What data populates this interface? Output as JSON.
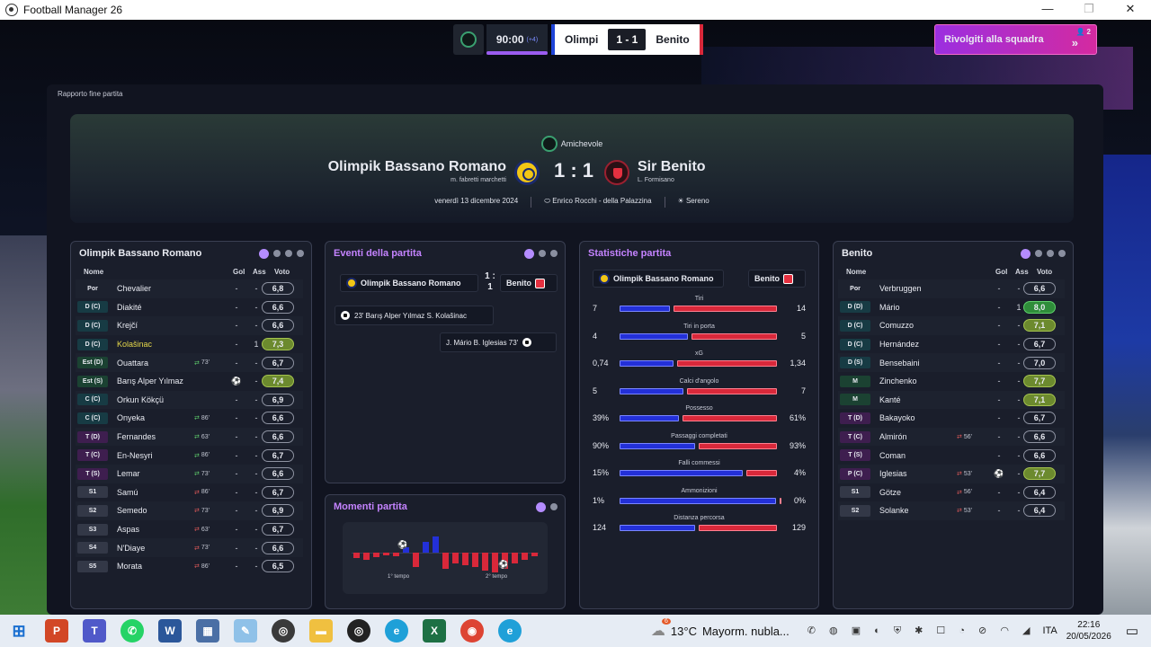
{
  "window": {
    "title": "Football Manager 26",
    "min": "—",
    "max": "❐",
    "close": "✕"
  },
  "topbar": {
    "time": "90:00",
    "extra_time": "(+4)",
    "home_short": "Olimpi",
    "score": "1 - 1",
    "away_short": "Benito",
    "rally_label": "Rivolgiti alla squadra",
    "rally_count": "2",
    "home_color": "#1e44d8",
    "away_color": "#d8283a",
    "accent": "#9b5cf0"
  },
  "breadcrumb": "Rapporto fine partita",
  "header": {
    "competition": "Amichevole",
    "home_team": "Olimpik Bassano Romano",
    "home_coach": "m. fabretti marchetti",
    "away_team": "Sir Benito",
    "away_coach": "L. Formisano",
    "score": "1 : 1",
    "date": "venerdì 13 dicembre 2024",
    "stadium": "Enrico Rocchi - della Palazzina",
    "weather": "Sereno"
  },
  "home_lineup": {
    "title": "Olimpik Bassano Romano",
    "headers": {
      "name": "Nome",
      "goals": "Gol",
      "assists": "Ass",
      "rating": "Voto"
    },
    "players": [
      {
        "pos": "Por",
        "cls": "gk",
        "name": "Chevalier",
        "gol": "-",
        "ass": "-",
        "rating": "6,8",
        "rc": ""
      },
      {
        "pos": "D (C)",
        "cls": "def",
        "name": "Diakité",
        "gol": "-",
        "ass": "-",
        "rating": "6,6",
        "rc": ""
      },
      {
        "pos": "D (C)",
        "cls": "def",
        "name": "Krejčí",
        "gol": "-",
        "ass": "-",
        "rating": "6,6",
        "rc": ""
      },
      {
        "pos": "D (C)",
        "cls": "def",
        "name": "Kolašinac",
        "gol": "-",
        "ass": "1",
        "rating": "7,3",
        "rc": "good",
        "hl": true
      },
      {
        "pos": "Est (D)",
        "cls": "mid",
        "name": "Ouattara",
        "gol": "-",
        "ass": "-",
        "rating": "6,7",
        "rc": "",
        "sub": "73'",
        "dir": "in"
      },
      {
        "pos": "Est (S)",
        "cls": "mid",
        "name": "Barış Alper Yılmaz",
        "gol": "",
        "ass": "-",
        "rating": "7,4",
        "rc": "good",
        "goal": true
      },
      {
        "pos": "C (C)",
        "cls": "def",
        "name": "Orkun Kökçü",
        "gol": "-",
        "ass": "-",
        "rating": "6,9",
        "rc": ""
      },
      {
        "pos": "C (C)",
        "cls": "def",
        "name": "Onyeka",
        "gol": "-",
        "ass": "-",
        "rating": "6,6",
        "rc": "",
        "sub": "86'",
        "dir": "in"
      },
      {
        "pos": "T (D)",
        "cls": "att",
        "name": "Fernandes",
        "gol": "-",
        "ass": "-",
        "rating": "6,6",
        "rc": "",
        "sub": "63'",
        "dir": "in"
      },
      {
        "pos": "T (C)",
        "cls": "att",
        "name": "En-Nesyri",
        "gol": "-",
        "ass": "-",
        "rating": "6,7",
        "rc": "",
        "sub": "86'",
        "dir": "in"
      },
      {
        "pos": "T (S)",
        "cls": "att",
        "name": "Lemar",
        "gol": "-",
        "ass": "-",
        "rating": "6,6",
        "rc": "",
        "sub": "73'",
        "dir": "in"
      },
      {
        "pos": "S1",
        "cls": "sub",
        "name": "Samú",
        "gol": "-",
        "ass": "-",
        "rating": "6,7",
        "rc": "",
        "sub": "86'",
        "dir": "out"
      },
      {
        "pos": "S2",
        "cls": "sub",
        "name": "Semedo",
        "gol": "-",
        "ass": "-",
        "rating": "6,9",
        "rc": "",
        "sub": "73'",
        "dir": "out"
      },
      {
        "pos": "S3",
        "cls": "sub",
        "name": "Aspas",
        "gol": "-",
        "ass": "-",
        "rating": "6,7",
        "rc": "",
        "sub": "63'",
        "dir": "out"
      },
      {
        "pos": "S4",
        "cls": "sub",
        "name": "N'Diaye",
        "gol": "-",
        "ass": "-",
        "rating": "6,6",
        "rc": "",
        "sub": "73'",
        "dir": "out"
      },
      {
        "pos": "S5",
        "cls": "sub",
        "name": "Morata",
        "gol": "-",
        "ass": "-",
        "rating": "6,5",
        "rc": "",
        "sub": "86'",
        "dir": "out"
      }
    ]
  },
  "away_lineup": {
    "title": "Benito",
    "headers": {
      "name": "Nome",
      "goals": "Gol",
      "assists": "Ass",
      "rating": "Voto"
    },
    "players": [
      {
        "pos": "Por",
        "cls": "gk",
        "name": "Verbruggen",
        "gol": "-",
        "ass": "-",
        "rating": "6,6",
        "rc": ""
      },
      {
        "pos": "D (D)",
        "cls": "def",
        "name": "Mário",
        "gol": "-",
        "ass": "1",
        "rating": "8,0",
        "rc": "top"
      },
      {
        "pos": "D (C)",
        "cls": "def",
        "name": "Comuzzo",
        "gol": "-",
        "ass": "-",
        "rating": "7,1",
        "rc": "good"
      },
      {
        "pos": "D (C)",
        "cls": "def",
        "name": "Hernández",
        "gol": "-",
        "ass": "-",
        "rating": "6,7",
        "rc": ""
      },
      {
        "pos": "D (S)",
        "cls": "def",
        "name": "Bensebaini",
        "gol": "-",
        "ass": "-",
        "rating": "7,0",
        "rc": ""
      },
      {
        "pos": "M",
        "cls": "mid",
        "name": "Zinchenko",
        "gol": "-",
        "ass": "-",
        "rating": "7,7",
        "rc": "good"
      },
      {
        "pos": "M",
        "cls": "mid",
        "name": "Kanté",
        "gol": "-",
        "ass": "-",
        "rating": "7,1",
        "rc": "good"
      },
      {
        "pos": "T (D)",
        "cls": "att",
        "name": "Bakayoko",
        "gol": "-",
        "ass": "-",
        "rating": "6,7",
        "rc": ""
      },
      {
        "pos": "T (C)",
        "cls": "att",
        "name": "Almirón",
        "gol": "-",
        "ass": "-",
        "rating": "6,6",
        "rc": "",
        "sub": "56'",
        "dir": "out"
      },
      {
        "pos": "T (S)",
        "cls": "att",
        "name": "Coman",
        "gol": "-",
        "ass": "-",
        "rating": "6,6",
        "rc": ""
      },
      {
        "pos": "P (C)",
        "cls": "att",
        "name": "Iglesias",
        "gol": "",
        "ass": "-",
        "rating": "7,7",
        "rc": "good",
        "sub": "53'",
        "dir": "out",
        "goal": true
      },
      {
        "pos": "S1",
        "cls": "sub",
        "name": "Götze",
        "gol": "-",
        "ass": "-",
        "rating": "6,4",
        "rc": "",
        "sub": "56'",
        "dir": "out"
      },
      {
        "pos": "S2",
        "cls": "sub",
        "name": "Solanke",
        "gol": "-",
        "ass": "-",
        "rating": "6,4",
        "rc": "",
        "sub": "53'",
        "dir": "out"
      }
    ]
  },
  "events": {
    "title": "Eventi della partita",
    "home": "Olimpik Bassano Romano",
    "score_top": "1 :",
    "score_bottom": "1",
    "away": "Benito",
    "home_event": "23'  Barış Alper Yılmaz  S. Kolašinac",
    "away_event": "J. Mário  B. Iglesias  73'"
  },
  "momentum": {
    "title": "Momenti partita",
    "first_half": "1° tempo",
    "second_half": "2° tempo"
  },
  "stats": {
    "title": "Statistiche partita",
    "home": "Olimpik Bassano Romano",
    "away": "Benito",
    "rows": [
      {
        "label": "Tiri",
        "home": "7",
        "away": "14",
        "hv": 7,
        "av": 14
      },
      {
        "label": "Tiri in porta",
        "home": "4",
        "away": "5",
        "hv": 4,
        "av": 5
      },
      {
        "label": "xG",
        "home": "0,74",
        "away": "1,34",
        "hv": 0.74,
        "av": 1.34
      },
      {
        "label": "Calci d'angolo",
        "home": "5",
        "away": "7",
        "hv": 5,
        "av": 7
      },
      {
        "label": "Possesso",
        "home": "39%",
        "away": "61%",
        "hv": 39,
        "av": 61
      },
      {
        "label": "Passaggi completati",
        "home": "90%",
        "away": "93%",
        "hv": 90,
        "av": 93
      },
      {
        "label": "Falli commessi",
        "home": "15%",
        "away": "4%",
        "hv": 15,
        "av": 4
      },
      {
        "label": "Ammonizioni",
        "home": "1%",
        "away": "0%",
        "hv": 1,
        "av": 0
      },
      {
        "label": "Distanza percorsa",
        "home": "124",
        "away": "129",
        "hv": 124,
        "av": 129
      }
    ]
  },
  "taskbar": {
    "temp": "13°C",
    "weather": "Mayorm. nubla...",
    "lang": "ITA",
    "time": "22:16",
    "date": "20/05/2026",
    "badge": "6"
  }
}
